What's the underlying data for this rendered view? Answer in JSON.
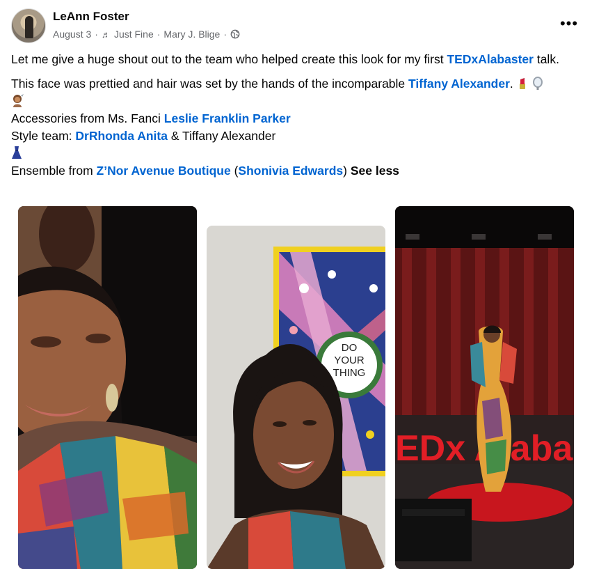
{
  "post": {
    "author": "LeAnn Foster",
    "date": "August 3",
    "song": "Just Fine",
    "artist": "Mary J. Blige",
    "separator": "·",
    "more_label": "•••",
    "line1_text": "Let me give a huge shout out to the team who helped create this look for my first ",
    "line1_link": "TEDxAlabaster",
    "line1_end": " talk.",
    "line2_text": "This face was prettied and hair was set by the hands of the incomparable ",
    "line2_link": "Tiffany Alexander",
    "line2_end": ".",
    "line3_text": "Accessories from Ms. Fanci ",
    "line3_link": "Leslie Franklin Parker",
    "line4_text": "Style team: ",
    "line4_link": "DrRhonda Anita",
    "line4_end": " & Tiffany Alexander",
    "line5_text": "Ensemble from ",
    "line5_link": "Z’Nor Avenue Boutique",
    "line5_paren_open": " (",
    "line5_link2": "Shonivia Edwards",
    "line5_paren_close": ") ",
    "see_less": "See less"
  },
  "photos": {
    "photo2_sign": [
      "DO",
      "YOUR",
      "THING"
    ],
    "photo3_stage_text": "EDx Alaba"
  },
  "colors": {
    "link": "#0064d1",
    "meta": "#65676b",
    "text": "#050505"
  },
  "icons": [
    "music-note-icon",
    "globe-icon",
    "more-options-icon",
    "lipstick-emoji",
    "mirror-emoji",
    "hairdresser-emoji",
    "dress-emoji"
  ]
}
